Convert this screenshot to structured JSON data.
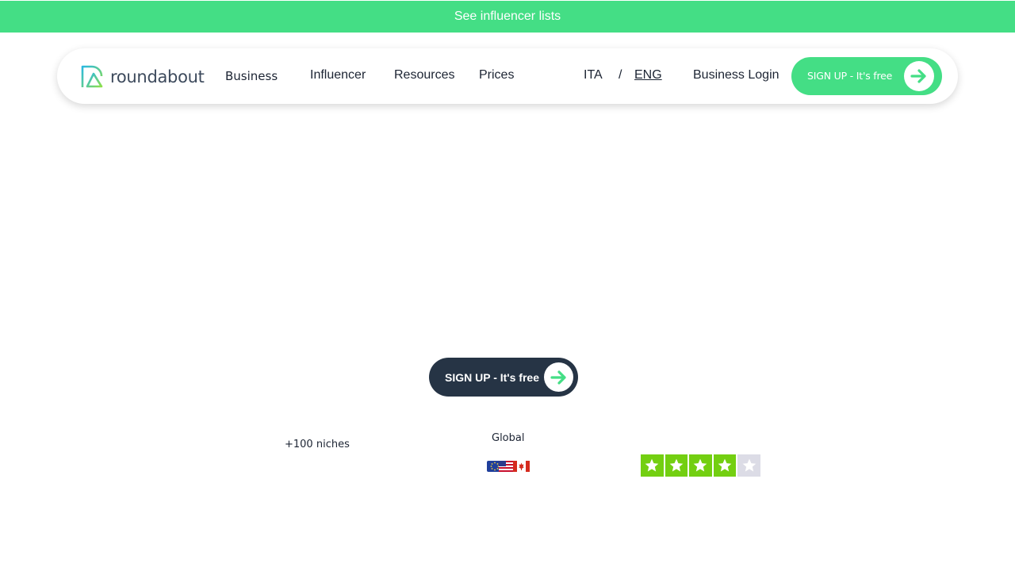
{
  "banner": {
    "text": "See influencer lists"
  },
  "nav": {
    "logo_text": "roundabout",
    "links": {
      "business": "Business",
      "influencer": "Influencer",
      "resources": "Resources",
      "prices": "Prices"
    },
    "lang": {
      "ita": "ITA",
      "separator": "/",
      "eng": "ENG",
      "active": "ENG"
    },
    "login": "Business Login",
    "signup": "SIGN UP - It's free"
  },
  "hero": {
    "cta": "SIGN UP - It's free"
  },
  "stats": {
    "niches": "+100 niches",
    "global": "Global",
    "flags": [
      "eu-flag-icon",
      "us-flag-icon",
      "canada-flag-icon"
    ],
    "rating": {
      "stars": 4,
      "max": 5
    }
  },
  "colors": {
    "brand_green": "#44de85",
    "dark_button": "#263445",
    "rating_green": "#73cf11",
    "rating_empty": "#dcdce6",
    "text": "#1c2433"
  }
}
